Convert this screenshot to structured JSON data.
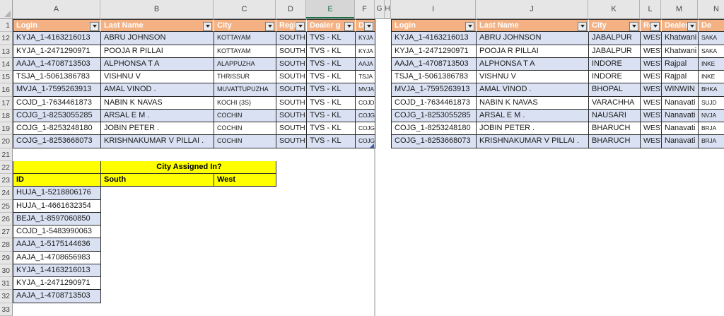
{
  "sheet": {
    "col_letters": [
      "A",
      "B",
      "C",
      "D",
      "E",
      "F",
      "G",
      "H",
      "I",
      "J",
      "K",
      "L",
      "M",
      "N"
    ],
    "row_numbers": [
      "1",
      "12",
      "13",
      "14",
      "15",
      "16",
      "17",
      "18",
      "19",
      "20",
      "21",
      "22",
      "23",
      "24",
      "25",
      "26",
      "27",
      "28",
      "29",
      "30",
      "31",
      "32",
      "33"
    ],
    "selected_column": "E"
  },
  "left_table": {
    "headers": [
      "Login",
      "Last Name",
      "City",
      "Regio",
      "Dealer g",
      "De"
    ],
    "rows": [
      [
        "KYJA_1-4163216013",
        "ABRU JOHNSON",
        "KOTTAYAM",
        "SOUTH",
        "TVS - KL",
        "KYJA"
      ],
      [
        "KYJA_1-2471290971",
        "POOJA R PILLAI",
        "KOTTAYAM",
        "SOUTH",
        "TVS - KL",
        "KYJA"
      ],
      [
        "AAJA_1-4708713503",
        "ALPHONSA T A",
        "ALAPPUZHA",
        "SOUTH",
        "TVS - KL",
        "AAJA"
      ],
      [
        "TSJA_1-5061386783",
        "VISHNU V",
        "THRISSUR",
        "SOUTH",
        "TVS - KL",
        "TSJA"
      ],
      [
        "MVJA_1-7595263913",
        "AMAL VINOD .",
        "MUVATTUPUZHA",
        "SOUTH",
        "TVS - KL",
        "MVJA"
      ],
      [
        "COJD_1-7634461873",
        "NABIN K NAVAS",
        "KOCHI (3S)",
        "SOUTH",
        "TVS - KL",
        "COJD"
      ],
      [
        "COJG_1-8253055285",
        "ARSAL E M .",
        "COCHIN",
        "SOUTH",
        "TVS - KL",
        "COJG"
      ],
      [
        "COJG_1-8253248180",
        "JOBIN PETER .",
        "COCHIN",
        "SOUTH",
        "TVS - KL",
        "COJG"
      ],
      [
        "COJG_1-8253668073",
        "KRISHNAKUMAR V PILLAI .",
        "COCHIN",
        "SOUTH",
        "TVS - KL",
        "COJG"
      ]
    ]
  },
  "right_table": {
    "headers": [
      "Login",
      "Last Name",
      "City",
      "Reg",
      "Dealer g",
      "De"
    ],
    "rows": [
      [
        "KYJA_1-4163216013",
        "ABRU JOHNSON",
        "JABALPUR",
        "WEST",
        "Khatwani",
        "SAKA"
      ],
      [
        "KYJA_1-2471290971",
        "POOJA R PILLAI",
        "JABALPUR",
        "WEST",
        "Khatwani",
        "SAKA"
      ],
      [
        "AAJA_1-4708713503",
        "ALPHONSA T A",
        "INDORE",
        "WEST",
        "Rajpal",
        "INKE"
      ],
      [
        "TSJA_1-5061386783",
        "VISHNU V",
        "INDORE",
        "WEST",
        "Rajpal",
        "INKE"
      ],
      [
        "MVJA_1-7595263913",
        "AMAL VINOD .",
        "BHOPAL",
        "WEST",
        "WINWIN",
        "BHKA"
      ],
      [
        "COJD_1-7634461873",
        "NABIN K NAVAS",
        "VARACHHA",
        "WEST",
        "Nanavati",
        "SUJD"
      ],
      [
        "COJG_1-8253055285",
        "ARSAL E M .",
        "NAUSARI",
        "WEST",
        "Nanavati",
        "NVJA"
      ],
      [
        "COJG_1-8253248180",
        "JOBIN PETER .",
        "BHARUCH",
        "WEST",
        "Nanavati",
        "BRJA"
      ],
      [
        "COJG_1-8253668073",
        "KRISHNAKUMAR V PILLAI .",
        "BHARUCH",
        "WEST",
        "Nanavati",
        "BRJA"
      ]
    ]
  },
  "lookup": {
    "title": "City Assigned In?",
    "id_header": "ID",
    "south_header": "South",
    "west_header": "West",
    "ids": [
      "HUJA_1-5218806176",
      "HUJA_1-4661632354",
      "BEJA_1-8597060850",
      "COJD_1-5483990063",
      "AAJA_1-5175144636",
      "AAJA_1-4708656983",
      "KYJA_1-4163216013",
      "KYJA_1-2471290971",
      "AAJA_1-4708713503"
    ]
  },
  "colors": {
    "table_header_fill": "#F4B183",
    "table_header_text": "#FFFFFF",
    "banded_row_fill": "#D9E1F2",
    "lookup_fill": "#FFFF00",
    "selected_column_accent": "#1E7145",
    "grid_header_fill": "#E6E6E6"
  }
}
